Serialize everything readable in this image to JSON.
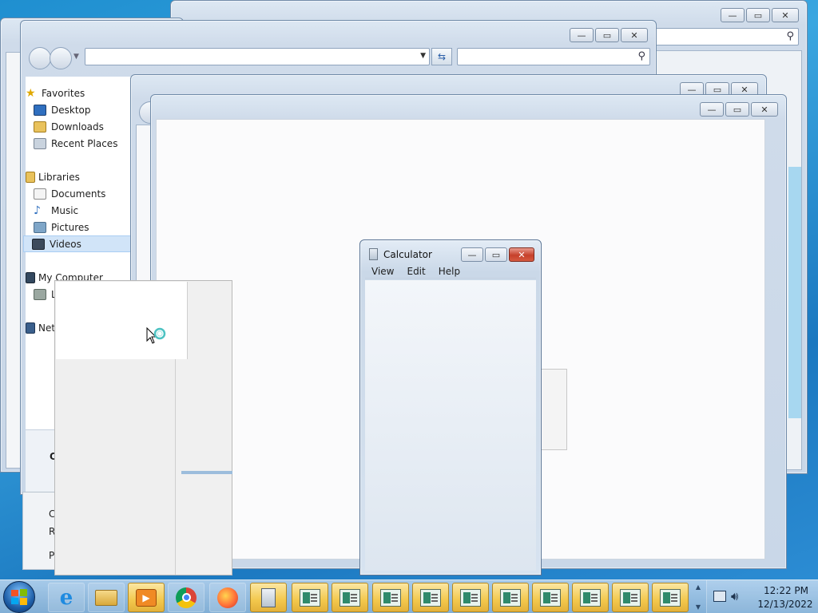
{
  "calculator": {
    "title": "Calculator",
    "menu": [
      "View",
      "Edit",
      "Help"
    ]
  },
  "explorer": {
    "nav": {
      "favorites_header": "Favorites",
      "favorites": [
        "Desktop",
        "Downloads",
        "Recent Places"
      ],
      "libraries_header": "Libraries",
      "libraries": [
        "Documents",
        "Music",
        "Pictures",
        "Videos"
      ],
      "selected": "Videos",
      "computer": "My Computer",
      "local_disk_partial": "Lo",
      "network_partial": "Net"
    },
    "bottom_partial_letters": [
      "O",
      "C",
      "R",
      "P"
    ]
  },
  "tray": {
    "time": "12:22 PM",
    "date": "12/13/2022"
  },
  "caption_glyphs": {
    "minimize": "—",
    "maximize": "▭",
    "close": "✕"
  },
  "colors": {
    "accent_taskbar_active": "#f3c84d",
    "close_red": "#c6402b",
    "selection_blue": "#d1e4f8"
  }
}
